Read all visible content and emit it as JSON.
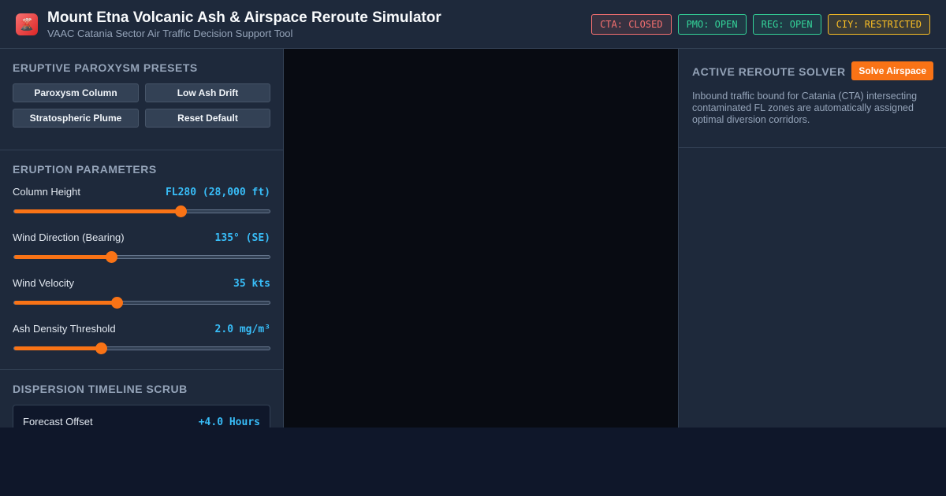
{
  "header": {
    "icon": "volcano-icon",
    "title": "Mount Etna Volcanic Ash & Airspace Reroute Simulator",
    "subtitle": "VAAC Catania Sector Air Traffic Decision Support Tool",
    "badges": [
      {
        "label": "CTA: CLOSED",
        "status": "closed",
        "color": "#f87171"
      },
      {
        "label": "PMO: OPEN",
        "status": "open",
        "color": "#34d399"
      },
      {
        "label": "REG: OPEN",
        "status": "open",
        "color": "#34d399"
      },
      {
        "label": "CIY: RESTRICTED",
        "status": "restricted",
        "color": "#fbbf24"
      }
    ]
  },
  "presets": {
    "title": "ERUPTIVE PAROXYSM PRESETS",
    "buttons": [
      "Paroxysm Column",
      "Low Ash Drift",
      "Stratospheric Plume",
      "Reset Default"
    ]
  },
  "parameters": {
    "title": "ERUPTION PARAMETERS",
    "items": [
      {
        "label": "Column Height",
        "value": "FL280 (28,000 ft)",
        "fraction": 0.65
      },
      {
        "label": "Wind Direction (Bearing)",
        "value": "135° (SE)",
        "fraction": 0.38
      },
      {
        "label": "Wind Velocity",
        "value": "35 kts",
        "fraction": 0.4
      },
      {
        "label": "Ash Density Threshold",
        "value": "2.0 mg/m³",
        "fraction": 0.34
      }
    ]
  },
  "timeline": {
    "title": "DISPERSION TIMELINE SCRUB",
    "label": "Forecast Offset",
    "value": "+4.0 Hours"
  },
  "solver": {
    "title": "ACTIVE REROUTE SOLVER",
    "button": "Solve Airspace",
    "description": "Inbound traffic bound for Catania (CTA) intersecting contaminated FL zones are automatically assigned optimal diversion corridors."
  },
  "colors": {
    "accent": "#f97316",
    "value_text": "#38bdf8",
    "panel": "#1e293b",
    "background": "#0f172a"
  }
}
